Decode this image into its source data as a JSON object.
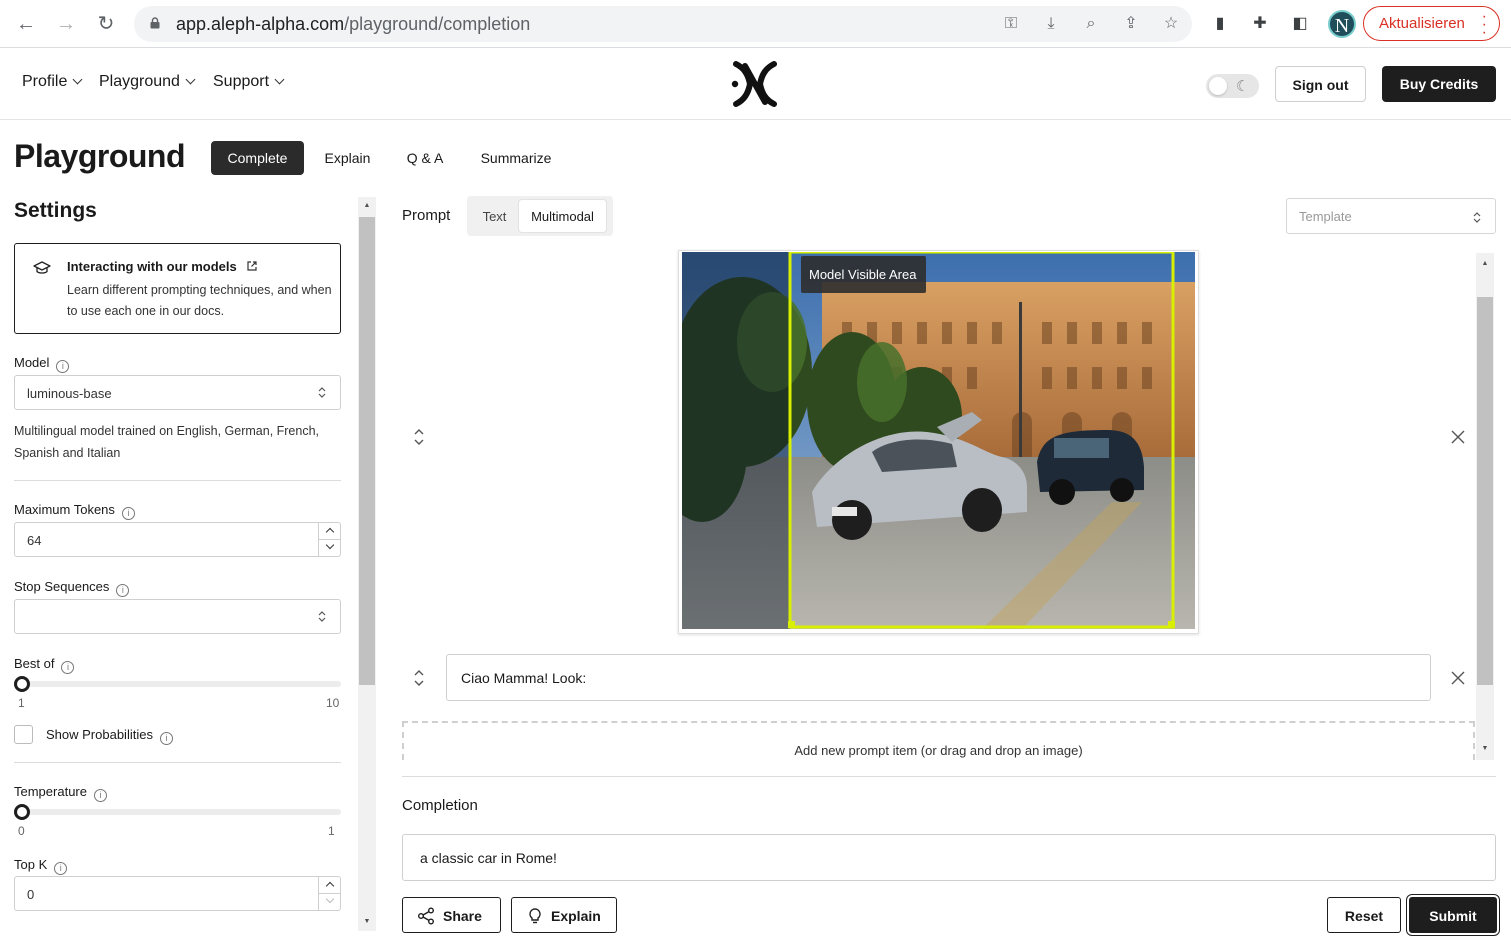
{
  "browser": {
    "url_host": "app.aleph-alpha.com",
    "url_path": "/playground/completion",
    "update_label": "Aktualisieren",
    "profile_initial": "N"
  },
  "header": {
    "menus": [
      "Profile",
      "Playground",
      "Support"
    ],
    "sign_out": "Sign out",
    "buy_credits": "Buy Credits"
  },
  "page": {
    "title": "Playground",
    "tabs": [
      "Complete",
      "Explain",
      "Q & A",
      "Summarize"
    ],
    "active_tab": "Complete"
  },
  "settings": {
    "title": "Settings",
    "info_card": {
      "title": "Interacting with our models",
      "description": "Learn different prompting techniques, and when to use each one in our docs."
    },
    "model": {
      "label": "Model",
      "value": "luminous-base",
      "description": "Multilingual model trained on English, German, French, Spanish and Italian"
    },
    "maximum_tokens": {
      "label": "Maximum Tokens",
      "value": "64"
    },
    "stop_sequences": {
      "label": "Stop Sequences",
      "value": ""
    },
    "best_of": {
      "label": "Best of",
      "min": "1",
      "max": "10",
      "value": 1
    },
    "show_probabilities": {
      "label": "Show Probabilities",
      "checked": false
    },
    "temperature": {
      "label": "Temperature",
      "min": "0",
      "max": "1",
      "value": 0
    },
    "top_k": {
      "label": "Top K",
      "value": "0"
    }
  },
  "prompt": {
    "label": "Prompt",
    "modes": [
      "Text",
      "Multimodal"
    ],
    "active_mode": "Multimodal",
    "template_placeholder": "Template",
    "image_overlay_label": "Model Visible Area",
    "text_item": "Ciao Mamma! Look:",
    "add_item": "Add new prompt item (or drag and drop an image)"
  },
  "completion": {
    "label": "Completion",
    "value": "a classic car in Rome!"
  },
  "actions": {
    "share": "Share",
    "explain": "Explain",
    "reset": "Reset",
    "submit": "Submit"
  },
  "colors": {
    "dark": "#1e1e1e",
    "visible_area_border": "#d8f000",
    "update_red": "#d93025"
  },
  "icons": [
    "back-icon",
    "forward-icon",
    "reload-icon",
    "lock-icon",
    "key-icon",
    "install-icon",
    "zoom-icon",
    "share-page-icon",
    "star-icon",
    "sidebar-icon",
    "extension-icon",
    "split-icon",
    "external-link-icon",
    "graduation-cap-icon",
    "info-icon",
    "moon-icon",
    "reorder-icon",
    "close-icon",
    "share-icon",
    "lightbulb-icon"
  ]
}
